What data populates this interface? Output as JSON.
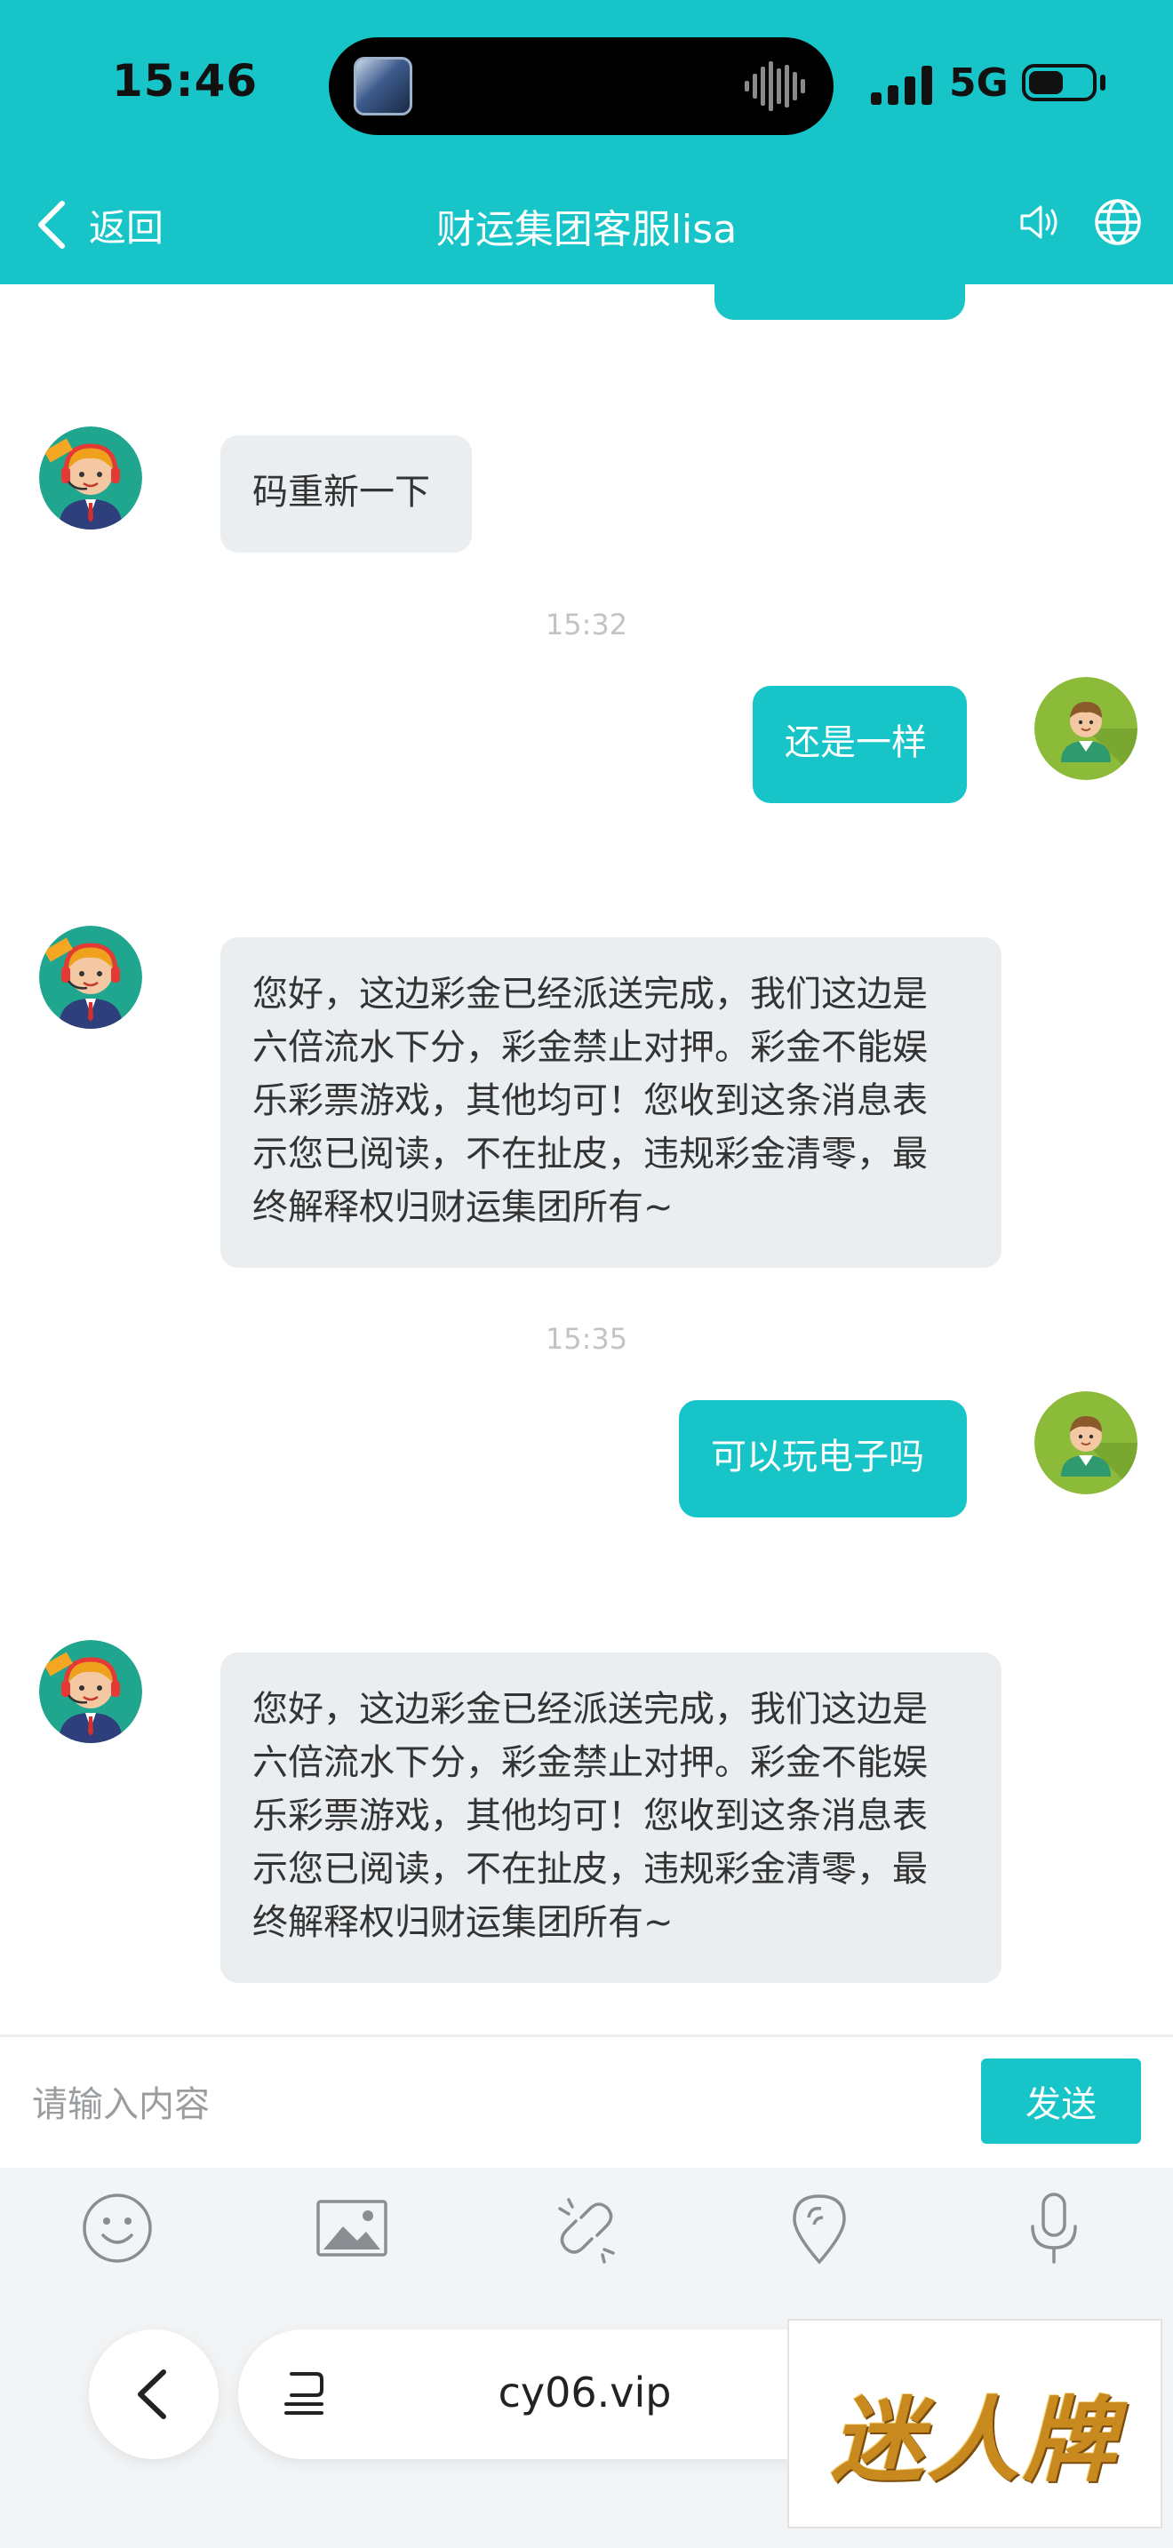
{
  "status_bar": {
    "time": "15:46",
    "network": "5G"
  },
  "header": {
    "back_label": "返回",
    "title": "财运集团客服lisa"
  },
  "chat": {
    "messages": [
      {
        "direction": "in",
        "text": "码重新一下"
      },
      {
        "timestamp": "15:32"
      },
      {
        "direction": "out",
        "text": "还是一样"
      },
      {
        "direction": "in",
        "lines": [
          "您好，这边彩金已经派送完成，我们这边是",
          "六倍流水下分，彩金禁止对押。彩金不能娱",
          "乐彩票游戏，其他均可！您收到这条消息表",
          "示您已阅读，不在扯皮，违规彩金清零，最",
          "终解释权归财运集团所有~"
        ]
      },
      {
        "timestamp": "15:35"
      },
      {
        "direction": "out",
        "text": "可以玩电子吗"
      },
      {
        "direction": "in",
        "lines": [
          "您好，这边彩金已经派送完成，我们这边是",
          "六倍流水下分，彩金禁止对押。彩金不能娱",
          "乐彩票游戏，其他均可！您收到这条消息表",
          "示您已阅读，不在扯皮，违规彩金清零，最",
          "终解释权归财运集团所有~"
        ]
      }
    ]
  },
  "input": {
    "placeholder": "请输入内容",
    "value": "",
    "send_label": "发送"
  },
  "toolbar": {
    "icons": [
      "emoji-icon",
      "image-icon",
      "link-icon",
      "location-icon",
      "microphone-icon"
    ]
  },
  "browser": {
    "url": "cy06.vip"
  },
  "watermark": {
    "text": "迷人牌"
  },
  "colors": {
    "brand": "#17c5c8",
    "incoming_bubble": "#eaeef0",
    "timestamp": "#c0c4c6"
  }
}
